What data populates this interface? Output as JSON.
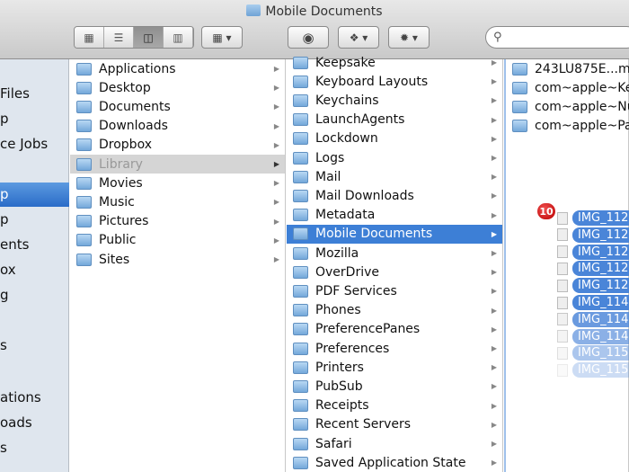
{
  "window": {
    "title": "Mobile Documents"
  },
  "toolbar": {
    "view_icons": [
      "icon-view",
      "list-view",
      "column-view",
      "coverflow-view"
    ],
    "arrange_icon": "arrange-icon",
    "quicklook_icon": "eye-icon",
    "dropbox_icon": "dropbox-icon",
    "action_icon": "gear-icon",
    "search_placeholder": ""
  },
  "sidebar": {
    "items": [
      {
        "label": "Files"
      },
      {
        "label": "p"
      },
      {
        "label": "ce Jobs"
      },
      {
        "label": "p",
        "selected": true
      },
      {
        "label": "p"
      },
      {
        "label": "ents"
      },
      {
        "label": "ox"
      },
      {
        "label": "g"
      },
      {
        "label": "s"
      },
      {
        "label": "ations"
      },
      {
        "label": "oads"
      },
      {
        "label": "s"
      }
    ]
  },
  "column1": {
    "items": [
      "Applications",
      "Desktop",
      "Documents",
      "Downloads",
      "Dropbox",
      "Library",
      "Movies",
      "Music",
      "Pictures",
      "Public",
      "Sites"
    ],
    "selected": "Library"
  },
  "column2": {
    "items": [
      "Keepsake",
      "Keyboard Layouts",
      "Keychains",
      "LaunchAgents",
      "Lockdown",
      "Logs",
      "Mail",
      "Mail Downloads",
      "Metadata",
      "Mobile Documents",
      "Mozilla",
      "OverDrive",
      "PDF Services",
      "Phones",
      "PreferencePanes",
      "Preferences",
      "Printers",
      "PubSub",
      "Receipts",
      "Recent Servers",
      "Safari",
      "Saved Application State"
    ],
    "selected": "Mobile Documents"
  },
  "column3": {
    "items": [
      "243LU875E...m",
      "com~apple~Key",
      "com~apple~Nur",
      "com~apple~Pag"
    ]
  },
  "drag": {
    "count": "10",
    "items": [
      "IMG_112",
      "IMG_112",
      "IMG_112",
      "IMG_112",
      "IMG_112",
      "IMG_114",
      "IMG_114",
      "IMG_114",
      "IMG_115",
      "IMG_115"
    ]
  }
}
